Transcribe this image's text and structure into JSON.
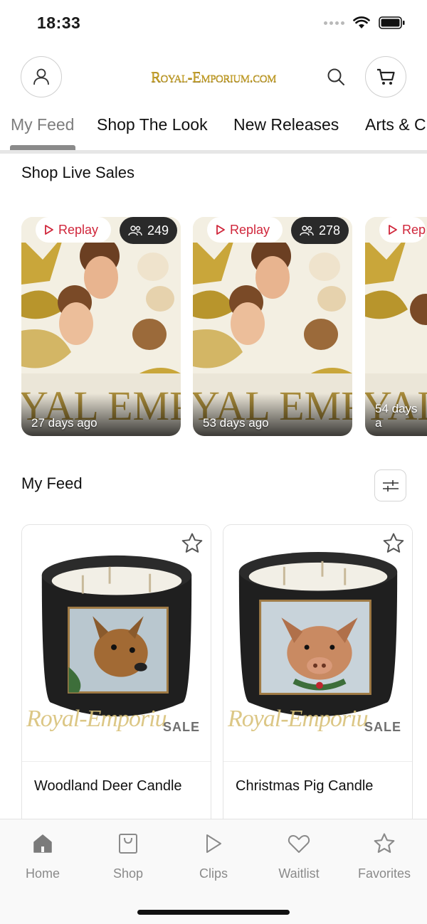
{
  "status_bar": {
    "time": "18:33"
  },
  "header": {
    "logo_text": "Royal-Emporium.com"
  },
  "tabs": [
    {
      "label": "My Feed",
      "active": true
    },
    {
      "label": "Shop The Look",
      "active": false
    },
    {
      "label": "New Releases",
      "active": false
    },
    {
      "label": "Arts & C",
      "active": false
    }
  ],
  "live_sales": {
    "title": "Shop Live Sales",
    "cards": [
      {
        "replay_label": "Replay",
        "viewers": "249",
        "age": "27 days ago"
      },
      {
        "replay_label": "Replay",
        "viewers": "278",
        "age": "53 days ago"
      },
      {
        "replay_label": "Rep",
        "viewers": "",
        "age": "54 days a"
      }
    ]
  },
  "feed": {
    "title": "My Feed",
    "products": [
      {
        "name": "Woodland Deer Candle",
        "badge": "SALE",
        "watermark": "Royal-Emporiu",
        "animal": "deer"
      },
      {
        "name": "Christmas Pig Candle",
        "badge": "SALE",
        "watermark": "Royal-Emporiu",
        "animal": "pig"
      }
    ]
  },
  "bottom_nav": [
    {
      "label": "Home",
      "icon": "home-icon",
      "active": true
    },
    {
      "label": "Shop",
      "icon": "shop-bag-icon",
      "active": false
    },
    {
      "label": "Clips",
      "icon": "play-icon",
      "active": false
    },
    {
      "label": "Waitlist",
      "icon": "heart-icon",
      "active": false
    },
    {
      "label": "Favorites",
      "icon": "star-icon",
      "active": false
    }
  ],
  "colors": {
    "accent_red": "#d0263b",
    "gold": "#c8a227",
    "nav_gray": "#8a8a8a"
  }
}
